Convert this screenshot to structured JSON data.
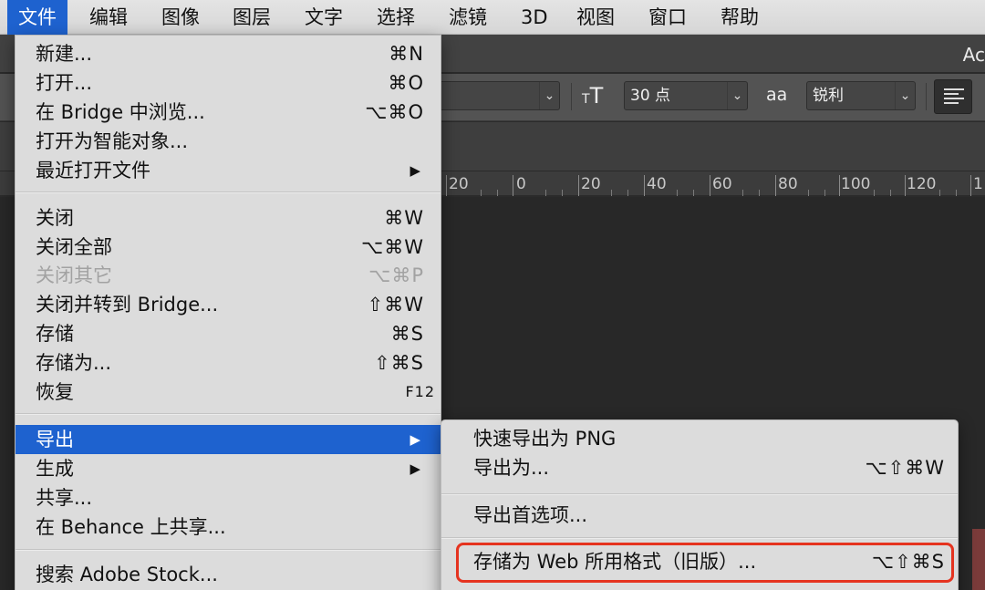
{
  "menubar": {
    "items": [
      "文件",
      "编辑",
      "图像",
      "图层",
      "文字",
      "选择",
      "滤镜",
      "3D",
      "视图",
      "窗口",
      "帮助"
    ]
  },
  "window": {
    "title": "Ac"
  },
  "options_bar": {
    "font_size": "30 点",
    "antialias_icon_text": "aa",
    "antialias": "锐利",
    "font_size_icon": "text-size-icon"
  },
  "ruler": {
    "labels": [
      "20",
      "0",
      "20",
      "40",
      "60",
      "80",
      "100",
      "120",
      "1"
    ]
  },
  "file_menu": {
    "items": [
      {
        "label": "新建...",
        "shortcut": "⌘N"
      },
      {
        "label": "打开...",
        "shortcut": "⌘O"
      },
      {
        "label": "在 Bridge 中浏览...",
        "shortcut": "⌥⌘O"
      },
      {
        "label": "打开为智能对象...",
        "shortcut": ""
      },
      {
        "label": "最近打开文件",
        "shortcut": "",
        "submenu": true
      },
      {
        "label": "关闭",
        "shortcut": "⌘W"
      },
      {
        "label": "关闭全部",
        "shortcut": "⌥⌘W"
      },
      {
        "label": "关闭其它",
        "shortcut": "⌥⌘P",
        "disabled": true
      },
      {
        "label": "关闭并转到 Bridge...",
        "shortcut": "⇧⌘W"
      },
      {
        "label": "存储",
        "shortcut": "⌘S"
      },
      {
        "label": "存储为...",
        "shortcut": "⇧⌘S"
      },
      {
        "label": "恢复",
        "shortcut": "F12"
      },
      {
        "label": "导出",
        "shortcut": "",
        "submenu": true,
        "highlighted": true
      },
      {
        "label": "生成",
        "shortcut": "",
        "submenu": true
      },
      {
        "label": "共享...",
        "shortcut": ""
      },
      {
        "label": "在 Behance 上共享...",
        "shortcut": ""
      },
      {
        "label": "搜索 Adobe Stock...",
        "shortcut": ""
      }
    ]
  },
  "export_menu": {
    "items": [
      {
        "label": "快速导出为 PNG",
        "shortcut": ""
      },
      {
        "label": "导出为...",
        "shortcut": "⌥⇧⌘W"
      },
      {
        "label": "导出首选项...",
        "shortcut": ""
      },
      {
        "label": "存储为 Web 所用格式（旧版）...",
        "shortcut": "⌥⇧⌘S"
      }
    ]
  },
  "colors": {
    "accent": "#1e62cf",
    "annotation": "#e5331f"
  }
}
